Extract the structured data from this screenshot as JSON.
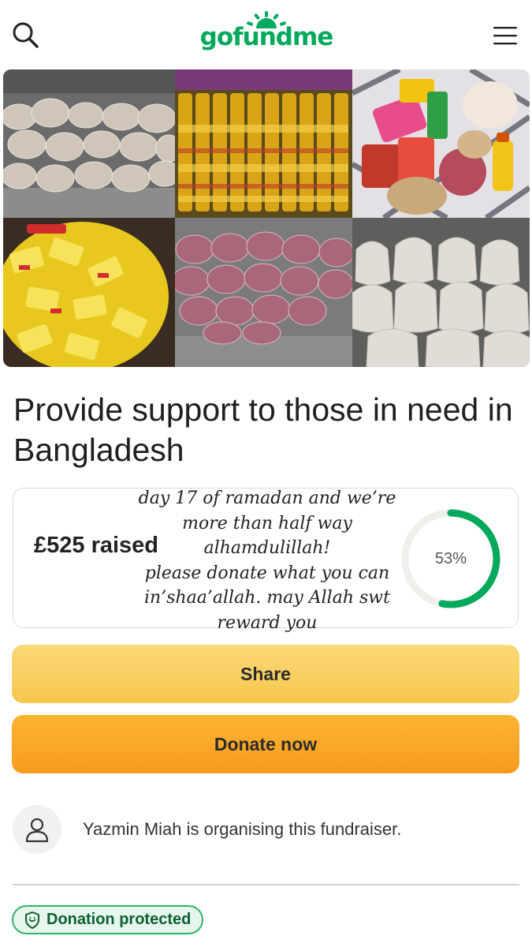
{
  "header": {
    "logo_text": "gofundme",
    "logo_color": "#02a95c",
    "search_icon": "search-icon",
    "menu_icon": "hamburger-menu-icon"
  },
  "gallery": {
    "tiles": [
      "bags-of-potatoes",
      "bottles-of-cooking-oil",
      "food-pack-contents",
      "yellow-product-packs",
      "bags-of-onions",
      "sacks-of-rice"
    ]
  },
  "campaign": {
    "title": "Provide support to those in need in Bangladesh"
  },
  "progress": {
    "raised_text": "£525 raised",
    "percent_text": "53%",
    "percent_value": 0.53,
    "ring_color": "#02a95c",
    "handwritten_note": [
      "day 17 of ramadan and we’re",
      "more than half way",
      "alhamdulillah!",
      "please donate what you can",
      "in’shaa’allah. may Allah swt",
      "reward you"
    ]
  },
  "actions": {
    "share_label": "Share",
    "donate_label": "Donate now"
  },
  "organiser": {
    "text": "Yazmin Miah is organising this fundraiser.",
    "avatar_icon": "user-icon"
  },
  "badge": {
    "label": "Donation protected",
    "icon": "shield-icon",
    "color": "#2fb36c"
  }
}
